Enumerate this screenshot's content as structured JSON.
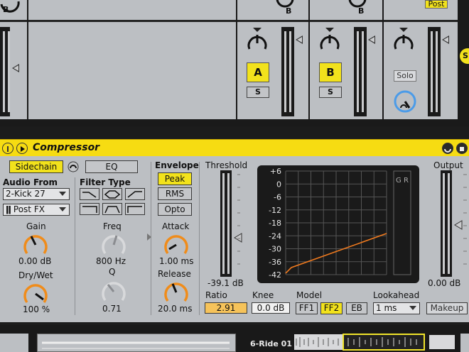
{
  "mixer": {
    "strips": [
      {
        "b_label": "B"
      },
      {
        "b_label": "B",
        "activator": "A",
        "solo": "S"
      },
      {
        "b_label": "B",
        "activator": "B",
        "solo": "S"
      },
      {
        "post": "Post",
        "solo_word": "Solo"
      }
    ],
    "side_badge": "S"
  },
  "device": {
    "title": "Compressor",
    "sidechain_label": "Sidechain",
    "eq_label": "EQ",
    "audio_from_label": "Audio From",
    "audio_from_value": "2-Kick 27",
    "post_fx_value": "Post FX",
    "filter_type_label": "Filter Type",
    "gain_label": "Gain",
    "gain_value": "0.00 dB",
    "drywet_label": "Dry/Wet",
    "drywet_value": "100 %",
    "freq_label": "Freq",
    "freq_value": "800 Hz",
    "q_label": "Q",
    "q_value": "0.71",
    "envelope_label": "Envelope",
    "env_buttons": [
      "Peak",
      "RMS",
      "Opto"
    ],
    "attack_label": "Attack",
    "attack_value": "1.00 ms",
    "release_label": "Release",
    "release_value": "20.0 ms",
    "threshold_label": "Threshold",
    "threshold_value": "-39.1 dB",
    "output_label": "Output",
    "output_value": "0.00 dB",
    "graph_ticks": [
      "+6",
      "0",
      "-6",
      "-12",
      "-18",
      "-24",
      "-30",
      "-36",
      "-42"
    ],
    "gr_label": "G R",
    "ratio_label": "Ratio",
    "ratio_value": "2.91",
    "knee_label": "Knee",
    "knee_value": "0.0 dB",
    "model_label": "Model",
    "model_buttons": [
      "FF1",
      "FF2",
      "EB"
    ],
    "lookahead_label": "Lookahead",
    "lookahead_value": "1 ms",
    "makeup_label": "Makeup",
    "colors": {
      "accent": "#f2e21c",
      "curve": "#f07a1e",
      "knob": "#f08c1a"
    }
  },
  "bottom": {
    "clip_label": "6-Ride 01"
  }
}
